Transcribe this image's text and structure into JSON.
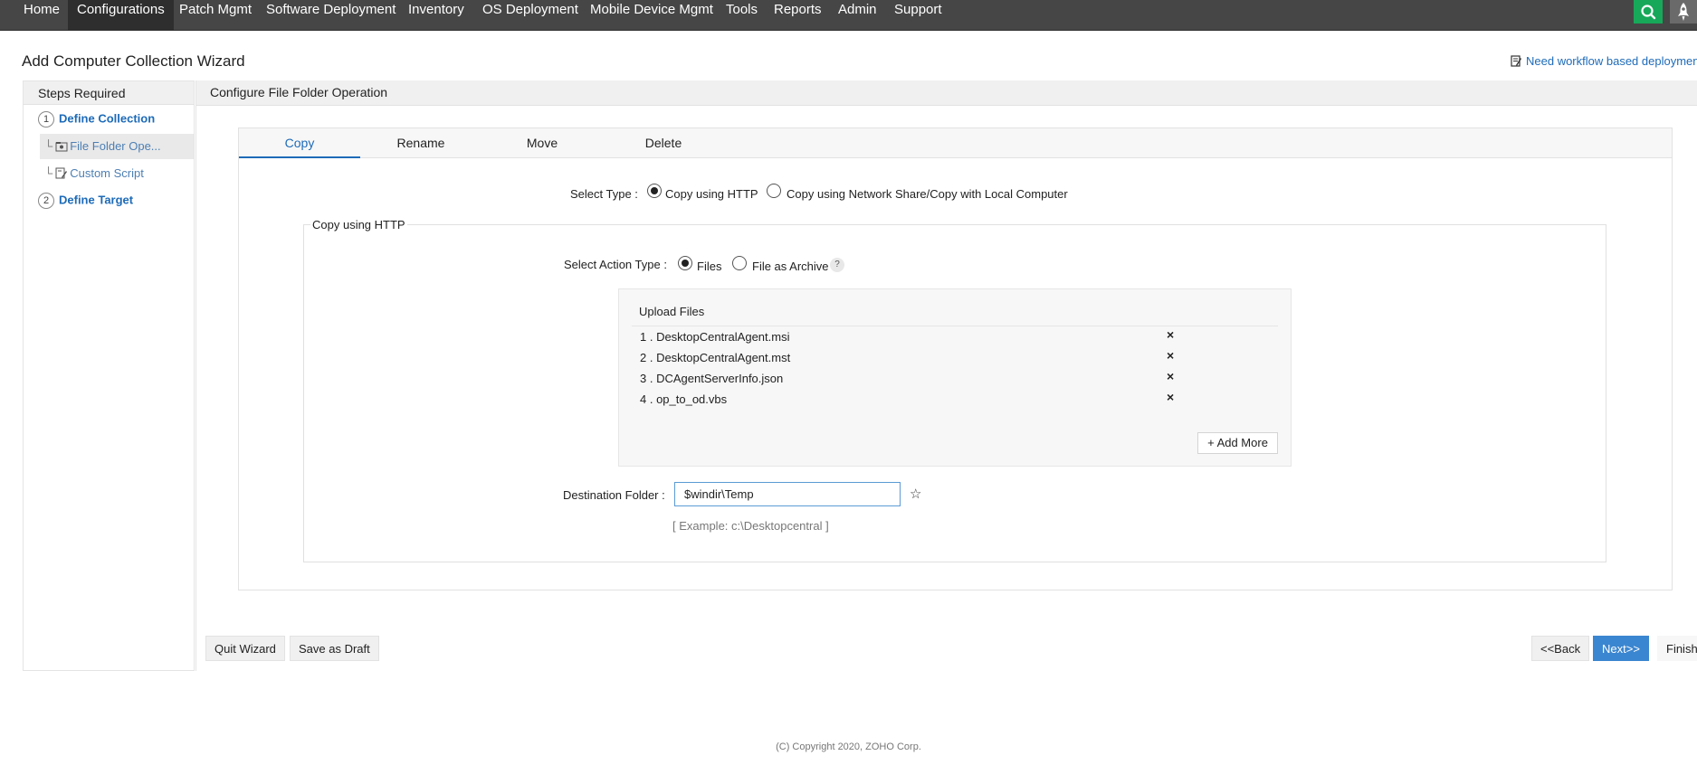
{
  "nav": {
    "items": [
      "Home",
      "Configurations",
      "Patch Mgmt",
      "Software Deployment",
      "Inventory",
      "OS Deployment",
      "Mobile Device Mgmt",
      "Tools",
      "Reports",
      "Admin",
      "Support"
    ],
    "active": "Configurations",
    "search_icon": "search-icon",
    "rocket_icon": "rocket-icon"
  },
  "page": {
    "title": "Add Computer Collection Wizard",
    "workflow_link": "Need workflow based deploymen"
  },
  "sidebar": {
    "header": "Steps Required",
    "steps": [
      {
        "num": "1",
        "label": "Define Collection"
      },
      {
        "num": "2",
        "label": "Define Target"
      }
    ],
    "subitems": [
      {
        "label": "File Folder Ope...",
        "selected": true
      },
      {
        "label": "Custom Script",
        "selected": false
      }
    ]
  },
  "main": {
    "header": "Configure File Folder Operation",
    "tabs": [
      "Copy",
      "Rename",
      "Move",
      "Delete"
    ],
    "active_tab": "Copy",
    "select_type": {
      "label": "Select Type :",
      "options": [
        "Copy using HTTP",
        "Copy using Network Share/Copy with Local Computer"
      ],
      "selected": "Copy using HTTP"
    },
    "section_legend": "Copy using HTTP",
    "action_type": {
      "label": "Select Action Type :",
      "options": [
        "Files",
        "File as Archive"
      ],
      "selected": "Files",
      "help": "?"
    },
    "upload": {
      "title": "Upload Files",
      "files": [
        "1 . DesktopCentralAgent.msi",
        "2 . DesktopCentralAgent.mst",
        "3 . DCAgentServerInfo.json",
        "4 . op_to_od.vbs"
      ],
      "remove_glyph": "×",
      "add_more": "Add More"
    },
    "destination": {
      "label": "Destination Folder :",
      "value": "$windir\\Temp",
      "example": "[ Example: c:\\Desktopcentral ]"
    }
  },
  "footer_buttons": {
    "quit": "Quit Wizard",
    "draft": "Save as Draft",
    "back": "<<Back",
    "next": "Next>>",
    "finish": "Finish"
  },
  "copyright": "(C) Copyright 2020, ZOHO Corp.",
  "colors": {
    "nav_bg": "#464646",
    "accent": "#1e6bb8",
    "search_green": "#17a85a",
    "primary_button": "#3b86d0"
  }
}
